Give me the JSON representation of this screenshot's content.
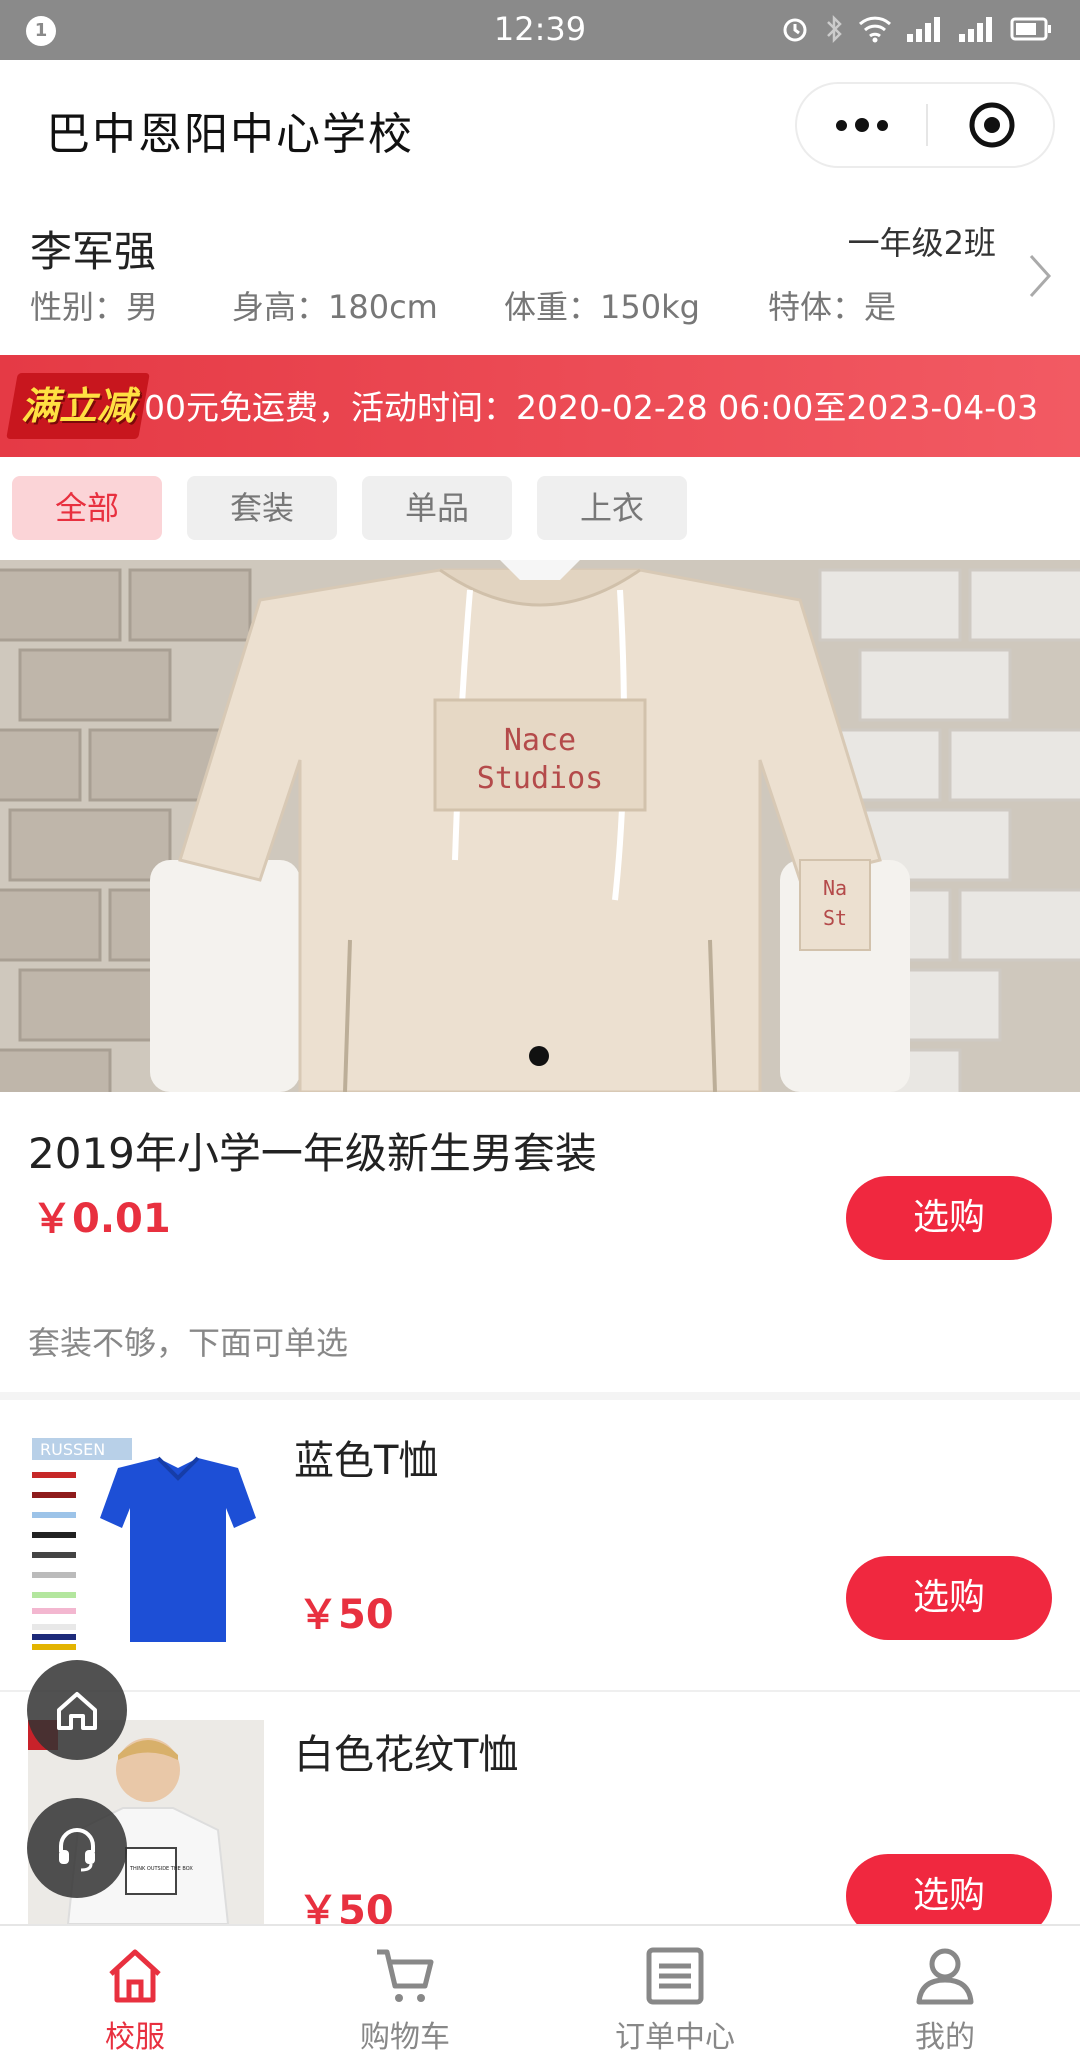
{
  "status_bar": {
    "notification_badge": "1",
    "time": "12:39",
    "icons": [
      "alarm-icon",
      "bluetooth-icon",
      "wifi-icon",
      "signal-icon",
      "signal-2-icon",
      "battery-icon"
    ]
  },
  "header": {
    "title": "巴中恩阳中心学校",
    "capsule": {
      "more_icon": "more-dots-icon",
      "close_icon": "target-close-icon"
    }
  },
  "student": {
    "name": "李军强",
    "class": "一年级2班",
    "gender": "性别：男",
    "height": "身高：180cm",
    "weight": "体重：150kg",
    "special": "特体：是"
  },
  "promo": {
    "badge": "满立减",
    "text": "00元免运费，活动时间：2020-02-28 06:00至2023-04-03"
  },
  "tabs": [
    {
      "label": "全部",
      "active": true
    },
    {
      "label": "套装",
      "active": false
    },
    {
      "label": "单品",
      "active": false
    },
    {
      "label": "上衣",
      "active": false
    }
  ],
  "hero": {
    "print_line1": "Nace",
    "print_line2": "Studios",
    "sleeve_print_line1": "Na",
    "sleeve_print_line2": "St",
    "slide_count": 1,
    "active_slide": 1
  },
  "featured": {
    "title": "2019年小学一年级新生男套装",
    "price": "￥0.01",
    "buy_label": "选购",
    "note": "套装不够，下面可单选"
  },
  "products": [
    {
      "name": "蓝色T恤",
      "price": "￥50",
      "buy_label": "选购",
      "image_brand": "RUSSEN",
      "color": "#1d4fd6"
    },
    {
      "name": "白色花纹T恤",
      "price": "￥50",
      "buy_label": "选购",
      "shirt_print": "THINK OUTSIDE THE BOX"
    }
  ],
  "floating": {
    "home_icon": "home-icon",
    "service_icon": "headset-icon"
  },
  "bottom_nav": [
    {
      "label": "校服",
      "icon": "home-icon",
      "active": true
    },
    {
      "label": "购物车",
      "icon": "cart-icon",
      "active": false
    },
    {
      "label": "订单中心",
      "icon": "list-icon",
      "active": false
    },
    {
      "label": "我的",
      "icon": "user-icon",
      "active": false
    }
  ],
  "colors": {
    "accent": "#e8303f",
    "button": "#f0283f",
    "promo": "#e53a45"
  }
}
